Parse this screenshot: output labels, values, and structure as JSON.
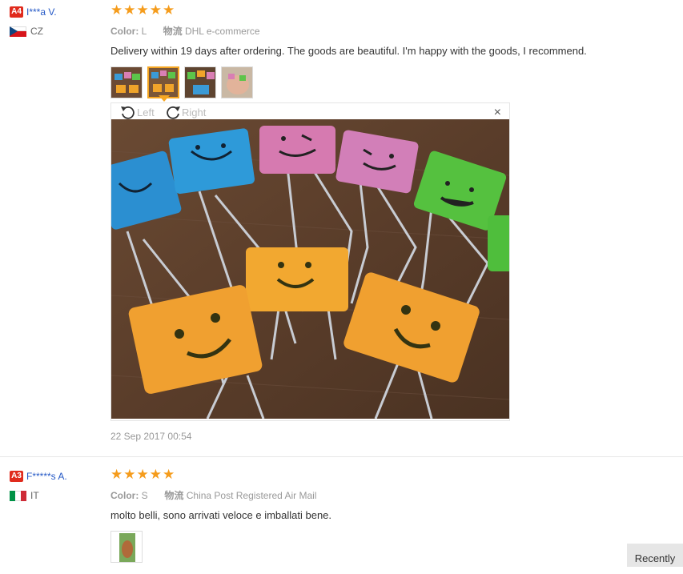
{
  "reviews": [
    {
      "level": "A4",
      "user": "I***a V.",
      "country": "CZ",
      "stars": "★★★★★",
      "color_label": "Color:",
      "color_value": "L",
      "shipping_label": "物流",
      "shipping_value": "DHL e-commerce",
      "text": "Delivery within 19 days after ordering. The goods are beautiful. I'm happy with the goods, I recommend.",
      "date": "22 Sep 2017 00:54",
      "viewer": {
        "left": "Left",
        "right": "Right",
        "close": "×"
      }
    },
    {
      "level": "A3",
      "user": "F*****s A.",
      "country": "IT",
      "stars": "★★★★★",
      "color_label": "Color:",
      "color_value": "S",
      "shipping_label": "物流",
      "shipping_value": "China Post Registered Air Mail",
      "text": "molto belli, sono arrivati veloce e imballati bene."
    }
  ],
  "footer": {
    "recently": "Recently"
  },
  "colors": {
    "star": "#f59c1c",
    "level_badge": "#e02b1d",
    "username": "#2458c6"
  }
}
